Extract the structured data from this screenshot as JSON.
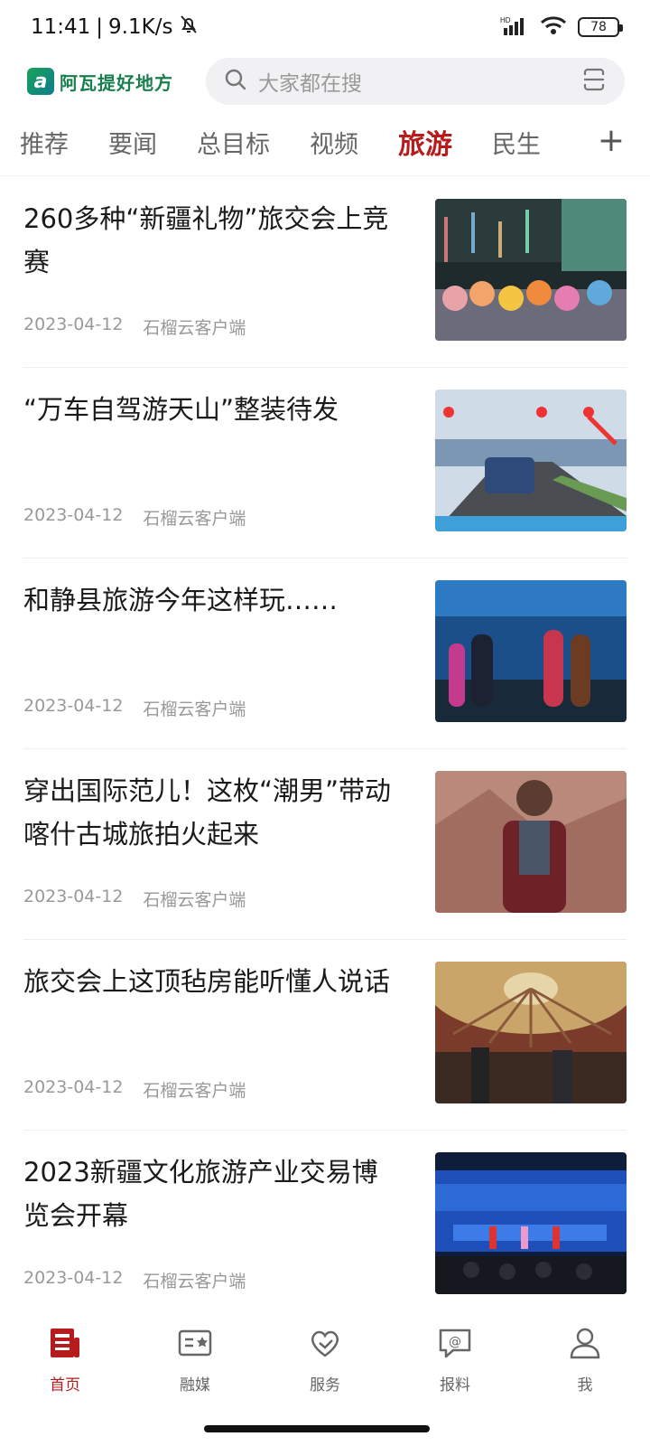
{
  "status_bar": {
    "time": "11:41",
    "separator": "|",
    "net_speed": "9.1K/s",
    "battery": "78",
    "icons": [
      "bell-muted-icon",
      "signal-icon",
      "wifi-icon",
      "battery-icon"
    ]
  },
  "header": {
    "logo_text": "阿瓦提好地方",
    "search_placeholder": "大家都在搜"
  },
  "tabs": [
    {
      "label": "推荐"
    },
    {
      "label": "要闻"
    },
    {
      "label": "总目标"
    },
    {
      "label": "视频"
    },
    {
      "label": "旅游"
    },
    {
      "label": "民生"
    }
  ],
  "active_tab": "旅游",
  "tab_add": "+",
  "news": [
    {
      "title": "260多种“新疆礼物”旅交会上竞赛",
      "date": "2023-04-12",
      "source": "石榴云客户端"
    },
    {
      "title": "“万车自驾游天山”整装待发",
      "date": "2023-04-12",
      "source": "石榴云客户端"
    },
    {
      "title": "和静县旅游今年这样玩……",
      "date": "2023-04-12",
      "source": "石榴云客户端"
    },
    {
      "title": "穿出国际范儿！这枚“潮男”带动喀什古城旅拍火起来",
      "date": "2023-04-12",
      "source": "石榴云客户端"
    },
    {
      "title": "旅交会上这顶毡房能听懂人说话",
      "date": "2023-04-12",
      "source": "石榴云客户端"
    },
    {
      "title": "2023新疆文化旅游产业交易博览会开幕",
      "date": "2023-04-12",
      "source": "石榴云客户端"
    }
  ],
  "bottom_nav": [
    {
      "label": "首页",
      "icon": "news-icon"
    },
    {
      "label": "融媒",
      "icon": "media-icon"
    },
    {
      "label": "服务",
      "icon": "heart-service-icon"
    },
    {
      "label": "报料",
      "icon": "report-icon"
    },
    {
      "label": "我",
      "icon": "user-icon"
    }
  ],
  "colors": {
    "accent": "#b71c1c",
    "logo_green": "#1a7f4e"
  }
}
